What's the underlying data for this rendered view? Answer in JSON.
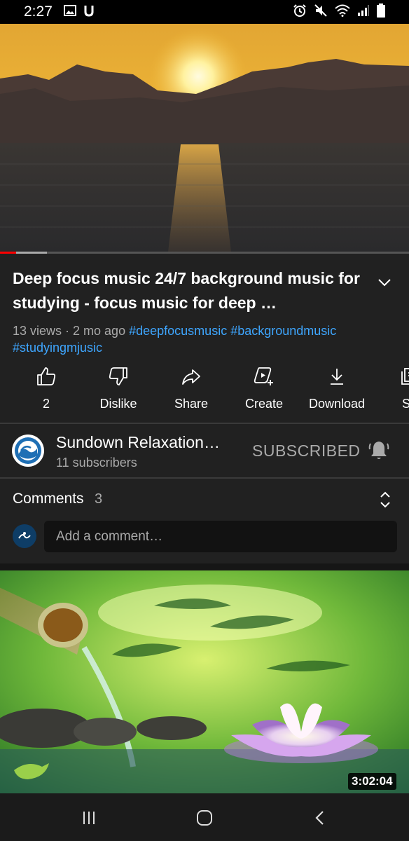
{
  "status_bar": {
    "time": "2:27",
    "left_icons": [
      "image-icon",
      "u-icon"
    ],
    "right_icons": [
      "alarm-icon",
      "mute-icon",
      "wifi-icon",
      "signal-icon",
      "battery-icon"
    ]
  },
  "player": {
    "thumbnail": "sunset-over-sea",
    "progress_fraction": 0.04,
    "buffer_fraction": 0.115
  },
  "video": {
    "title": "Deep focus music 24/7 background music for studying - focus music for deep …",
    "views": "13 views",
    "separator": " · ",
    "age": "2 mo ago",
    "hashtags": [
      "#deepfocusmusic",
      "#backgroundmusic",
      "#studyingmjusic"
    ]
  },
  "actions": [
    {
      "name": "like",
      "icon": "thumbs-up-icon",
      "label": "2"
    },
    {
      "name": "dislike",
      "icon": "thumbs-down-icon",
      "label": "Dislike"
    },
    {
      "name": "share",
      "icon": "share-icon",
      "label": "Share"
    },
    {
      "name": "create",
      "icon": "create-icon",
      "label": "Create"
    },
    {
      "name": "download",
      "icon": "download-icon",
      "label": "Download"
    },
    {
      "name": "save",
      "icon": "save-icon",
      "label": "Sa"
    }
  ],
  "channel": {
    "name": "Sundown Relaxation…",
    "subscribers": "11 subscribers",
    "subscribe_label": "SUBSCRIBED",
    "bell_icon": "bell-icon"
  },
  "comments": {
    "label": "Comments",
    "count": "3",
    "placeholder": "Add a comment…"
  },
  "next_video": {
    "thumbnail": "bamboo-fountain-lotus",
    "duration": "3:02:04"
  },
  "nav": {
    "buttons": [
      "recents-icon",
      "home-icon",
      "back-icon"
    ]
  },
  "colors": {
    "background": "#212121",
    "link": "#3ea6ff",
    "progress": "#ff0000",
    "muted_text": "#aaaaaa"
  }
}
